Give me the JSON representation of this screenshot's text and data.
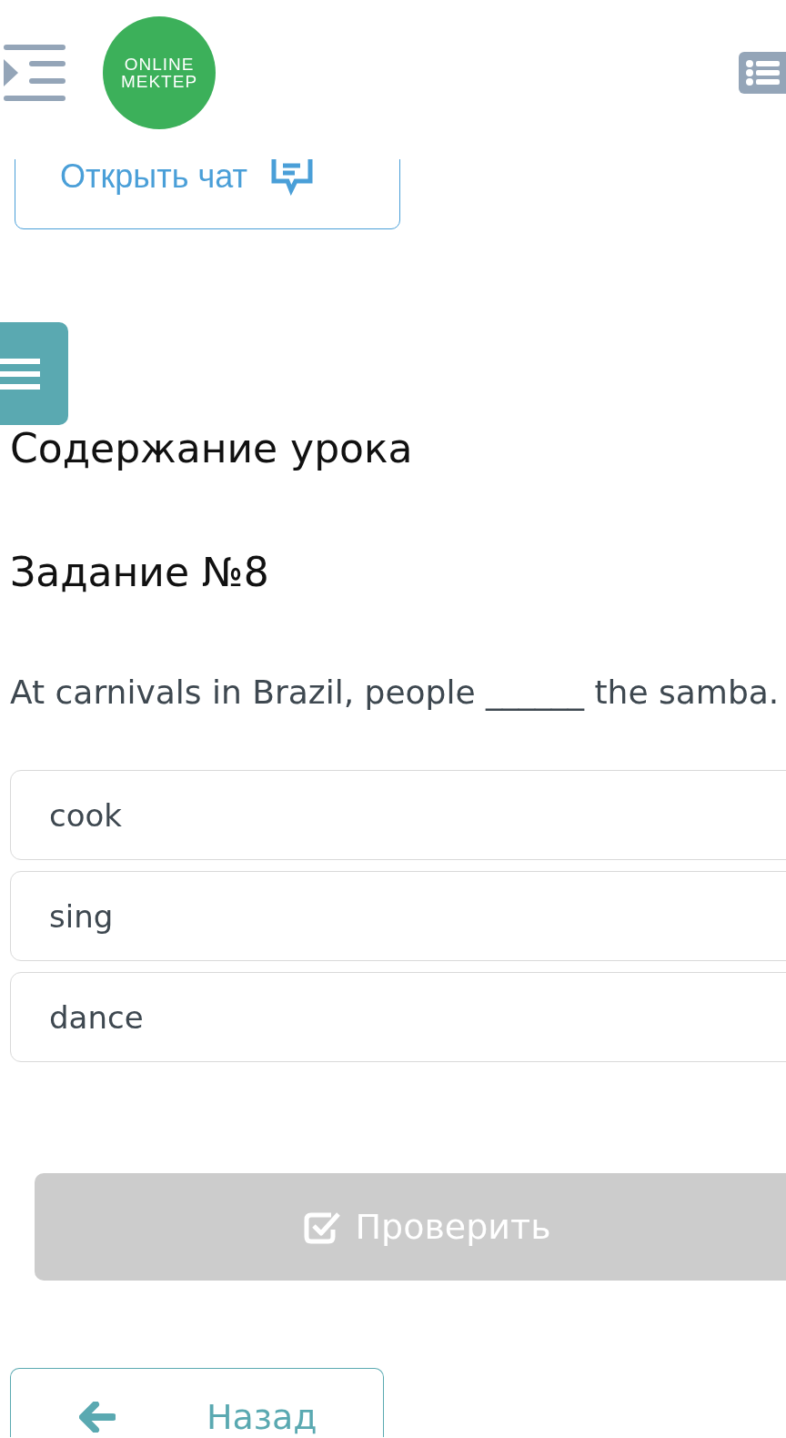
{
  "header": {
    "logo": {
      "line_1": "ONLINE",
      "line_2": "MEKTEP"
    }
  },
  "chat_button": {
    "label": "Открыть чат"
  },
  "lesson_title": "Содержание урока",
  "task_title": "Задание №8",
  "question": "At carnivals in Brazil, people ______ the samba.",
  "options": [
    {
      "label": "cook",
      "selected": false
    },
    {
      "label": "sing",
      "selected": false
    },
    {
      "label": "dance",
      "selected": false
    }
  ],
  "check_button": {
    "label": "Проверить",
    "disabled": true
  },
  "back_button": {
    "label": "Назад"
  }
}
